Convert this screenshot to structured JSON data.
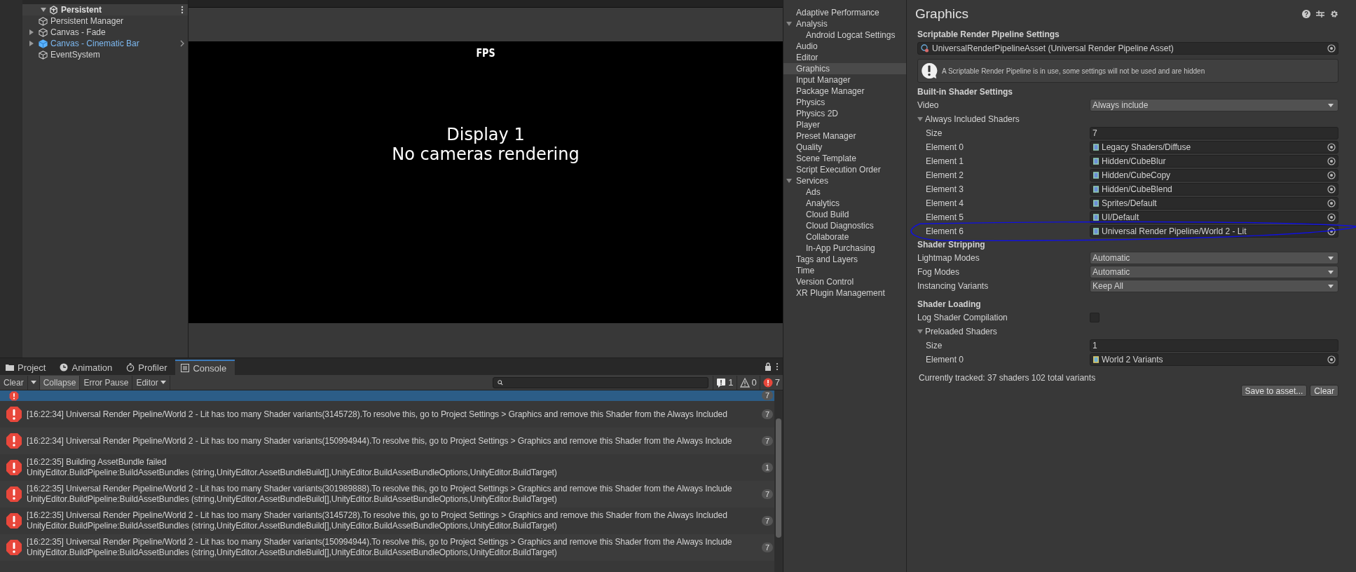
{
  "hierarchy": {
    "scene": "Persistent",
    "items": [
      {
        "name": "Persistent Manager",
        "has_children": false,
        "prefab": false
      },
      {
        "name": "Canvas - Fade",
        "has_children": true,
        "prefab": false
      },
      {
        "name": "Canvas - Cinematic Bar",
        "has_children": true,
        "prefab": true
      },
      {
        "name": "EventSystem",
        "has_children": false,
        "prefab": false
      }
    ]
  },
  "game_view": {
    "overlay_label": "FPS",
    "message_lines": [
      "Display 1",
      "No cameras rendering"
    ]
  },
  "console": {
    "tabs": [
      {
        "label": "Project",
        "kind": "folder",
        "selected": false
      },
      {
        "label": "Animation",
        "kind": "clock",
        "selected": false
      },
      {
        "label": "Profiler",
        "kind": "gauge",
        "selected": false
      },
      {
        "label": "Console",
        "kind": "list",
        "selected": true
      }
    ],
    "toolbar": {
      "clear": "Clear",
      "collapse": {
        "label": "Collapse",
        "on": true
      },
      "error_pause": {
        "label": "Error Pause",
        "on": false
      },
      "editor": "Editor"
    },
    "counts": {
      "info": "1",
      "warning": "0",
      "error": "7"
    },
    "rows": [
      {
        "count": "7",
        "selected": true
      },
      {
        "lines": [
          "[16:22:34] Universal Render Pipeline/World 2 - Lit has too many Shader variants(3145728).To resolve this, go to Project Settings > Graphics and remove this Shader from the Always Included"
        ],
        "count": "7",
        "selected": false
      },
      {
        "lines": [
          "[16:22:34] Universal Render Pipeline/World 2 - Lit has too many Shader variants(150994944).To resolve this, go to Project Settings > Graphics and remove this Shader from the Always Include"
        ],
        "count": "7",
        "selected": false
      },
      {
        "lines": [
          "[16:22:35] Building AssetBundle failed",
          "UnityEditor.BuildPipeline:BuildAssetBundles (string,UnityEditor.AssetBundleBuild[],UnityEditor.BuildAssetBundleOptions,UnityEditor.BuildTarget)"
        ],
        "count": "1",
        "selected": false
      },
      {
        "lines": [
          "[16:22:35] Universal Render Pipeline/World 2 - Lit has too many Shader variants(301989888).To resolve this, go to Project Settings > Graphics and remove this Shader from the Always Include",
          "UnityEditor.BuildPipeline:BuildAssetBundles (string,UnityEditor.AssetBundleBuild[],UnityEditor.BuildAssetBundleOptions,UnityEditor.BuildTarget)"
        ],
        "count": "7",
        "selected": false
      },
      {
        "lines": [
          "[16:22:35] Universal Render Pipeline/World 2 - Lit has too many Shader variants(3145728).To resolve this, go to Project Settings > Graphics and remove this Shader from the Always Included",
          "UnityEditor.BuildPipeline:BuildAssetBundles (string,UnityEditor.AssetBundleBuild[],UnityEditor.BuildAssetBundleOptions,UnityEditor.BuildTarget)"
        ],
        "count": "7",
        "selected": false
      },
      {
        "lines": [
          "[16:22:35] Universal Render Pipeline/World 2 - Lit has too many Shader variants(150994944).To resolve this, go to Project Settings > Graphics and remove this Shader from the Always Include",
          "UnityEditor.BuildPipeline:BuildAssetBundles (string,UnityEditor.AssetBundleBuild[],UnityEditor.BuildAssetBundleOptions,UnityEditor.BuildTarget)"
        ],
        "count": "7",
        "selected": false
      }
    ]
  },
  "settings_sidebar": {
    "items": [
      {
        "label": "Adaptive Performance",
        "selected": false
      },
      {
        "label": "Analysis",
        "selected": false,
        "expanded": true,
        "children": [
          {
            "label": "Android Logcat Settings",
            "selected": false
          }
        ]
      },
      {
        "label": "Audio",
        "selected": false
      },
      {
        "label": "Editor",
        "selected": false
      },
      {
        "label": "Graphics",
        "selected": true
      },
      {
        "label": "Input Manager",
        "selected": false
      },
      {
        "label": "Package Manager",
        "selected": false
      },
      {
        "label": "Physics",
        "selected": false
      },
      {
        "label": "Physics 2D",
        "selected": false
      },
      {
        "label": "Player",
        "selected": false
      },
      {
        "label": "Preset Manager",
        "selected": false
      },
      {
        "label": "Quality",
        "selected": false
      },
      {
        "label": "Scene Template",
        "selected": false
      },
      {
        "label": "Script Execution Order",
        "selected": false
      },
      {
        "label": "Services",
        "selected": false,
        "expanded": true,
        "children": [
          {
            "label": "Ads",
            "selected": false
          },
          {
            "label": "Analytics",
            "selected": false
          },
          {
            "label": "Cloud Build",
            "selected": false
          },
          {
            "label": "Cloud Diagnostics",
            "selected": false
          },
          {
            "label": "Collaborate",
            "selected": false
          },
          {
            "label": "In-App Purchasing",
            "selected": false
          }
        ]
      },
      {
        "label": "Tags and Layers",
        "selected": false
      },
      {
        "label": "Time",
        "selected": false
      },
      {
        "label": "Version Control",
        "selected": false
      },
      {
        "label": "XR Plugin Management",
        "selected": false
      }
    ]
  },
  "graphics": {
    "title": "Graphics",
    "srp": {
      "heading": "Scriptable Render Pipeline Settings",
      "asset": "UniversalRenderPipelineAsset (Universal Render Pipeline Asset)",
      "notice": "A Scriptable Render Pipeline is in use, some settings will not be used and are hidden"
    },
    "builtin": {
      "heading": "Built-in Shader Settings",
      "video": {
        "label": "Video",
        "value": "Always include"
      },
      "always_included": {
        "label": "Always Included Shaders",
        "expanded": true,
        "size_label": "Size",
        "size": "7",
        "elements": [
          {
            "label": "Element 0",
            "value": "Legacy Shaders/Diffuse",
            "circled": false
          },
          {
            "label": "Element 1",
            "value": "Hidden/CubeBlur",
            "circled": false
          },
          {
            "label": "Element 2",
            "value": "Hidden/CubeCopy",
            "circled": false
          },
          {
            "label": "Element 3",
            "value": "Hidden/CubeBlend",
            "circled": false
          },
          {
            "label": "Element 4",
            "value": "Sprites/Default",
            "circled": false
          },
          {
            "label": "Element 5",
            "value": "UI/Default",
            "circled": false
          },
          {
            "label": "Element 6",
            "value": "Universal Render Pipeline/World 2 - Lit",
            "circled": true
          }
        ]
      }
    },
    "stripping": {
      "heading": "Shader Stripping",
      "fields": [
        {
          "label": "Lightmap Modes",
          "value": "Automatic"
        },
        {
          "label": "Fog Modes",
          "value": "Automatic"
        },
        {
          "label": "Instancing Variants",
          "value": "Keep All"
        }
      ]
    },
    "loading": {
      "heading": "Shader Loading",
      "log": {
        "label": "Log Shader Compilation",
        "checked": false
      },
      "preloaded": {
        "label": "Preloaded Shaders",
        "expanded": true,
        "size_label": "Size",
        "size": "1",
        "elements": [
          {
            "label": "Element 0",
            "value": "World 2 Variants",
            "circled": false
          }
        ]
      }
    },
    "tracked": "Currently tracked: 37 shaders 102 total variants",
    "buttons": [
      "Save to asset...",
      "Clear"
    ]
  }
}
